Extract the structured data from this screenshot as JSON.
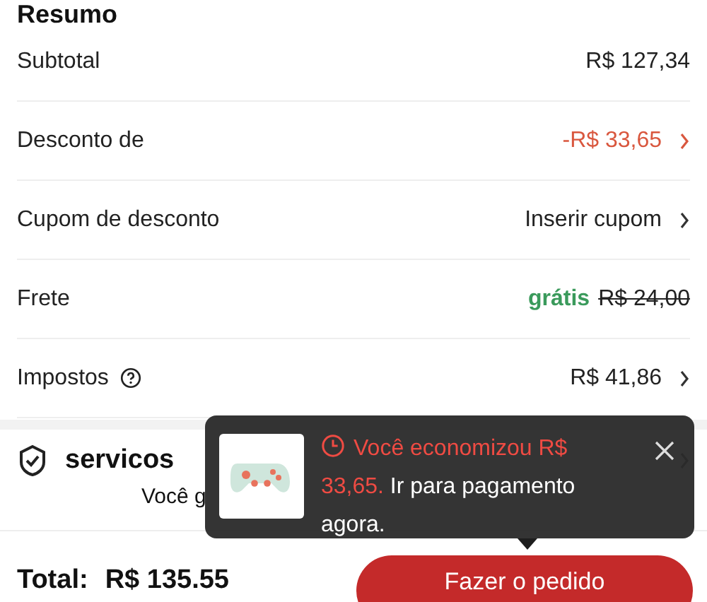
{
  "summary": {
    "title": "Resumo",
    "rows": [
      {
        "kind": "plain",
        "label": "Subtotal",
        "value": "R$ 127,34"
      },
      {
        "kind": "discount",
        "label": "Desconto de",
        "value": "-R$ 33,65"
      },
      {
        "kind": "link",
        "label": "Cupom de desconto",
        "value": "Inserir cupom"
      },
      {
        "kind": "shipping",
        "label": "Frete",
        "free_label": "grátis",
        "value": "R$ 24,00"
      },
      {
        "kind": "tax",
        "label": "Impostos",
        "value": "R$ 41,86"
      }
    ]
  },
  "services": {
    "title": "servicos",
    "credit_start": "Você g"
  },
  "toast": {
    "highlight": "Você economizou R$ 33,65.",
    "message": " Ir para pagamento agora."
  },
  "footer": {
    "total_label": "Total:",
    "total_value": "R$ 135.55",
    "order_button": "Fazer o pedido"
  }
}
